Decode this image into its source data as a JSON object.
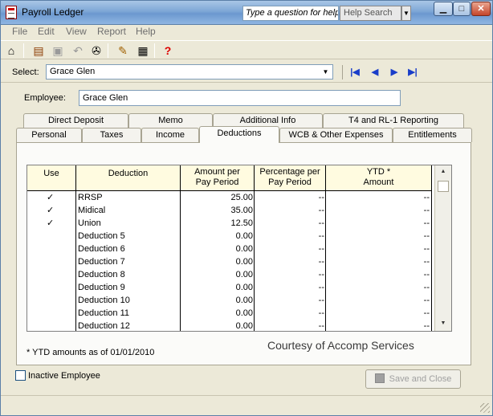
{
  "window": {
    "title": "Payroll Ledger"
  },
  "help": {
    "question_placeholder": "Type a question for help",
    "search_label": "Help Search"
  },
  "menu": [
    "File",
    "Edit",
    "View",
    "Report",
    "Help"
  ],
  "select": {
    "label": "Select:",
    "value": "Grace Glen"
  },
  "employee": {
    "label": "Employee:",
    "value": "Grace Glen"
  },
  "tabs_back": [
    "Direct Deposit",
    "Memo",
    "Additional Info",
    "T4 and RL-1 Reporting"
  ],
  "tabs_front": [
    "Personal",
    "Taxes",
    "Income",
    "Deductions",
    "WCB & Other Expenses",
    "Entitlements"
  ],
  "active_tab": "Deductions",
  "table": {
    "headers": [
      "Use",
      "Deduction",
      "Amount per Pay Period",
      "Percentage per Pay Period",
      "YTD * Amount"
    ],
    "rows": [
      {
        "use": "✓",
        "deduction": "RRSP",
        "amount": "25.00",
        "percentage": "--",
        "ytd": "--"
      },
      {
        "use": "✓",
        "deduction": "Midical",
        "amount": "35.00",
        "percentage": "--",
        "ytd": "--"
      },
      {
        "use": "✓",
        "deduction": "Union",
        "amount": "12.50",
        "percentage": "--",
        "ytd": "--"
      },
      {
        "use": "",
        "deduction": "Deduction 5",
        "amount": "0.00",
        "percentage": "--",
        "ytd": "--"
      },
      {
        "use": "",
        "deduction": "Deduction 6",
        "amount": "0.00",
        "percentage": "--",
        "ytd": "--"
      },
      {
        "use": "",
        "deduction": "Deduction 7",
        "amount": "0.00",
        "percentage": "--",
        "ytd": "--"
      },
      {
        "use": "",
        "deduction": "Deduction 8",
        "amount": "0.00",
        "percentage": "--",
        "ytd": "--"
      },
      {
        "use": "",
        "deduction": "Deduction 9",
        "amount": "0.00",
        "percentage": "--",
        "ytd": "--"
      },
      {
        "use": "",
        "deduction": "Deduction 10",
        "amount": "0.00",
        "percentage": "--",
        "ytd": "--"
      },
      {
        "use": "",
        "deduction": "Deduction 11",
        "amount": "0.00",
        "percentage": "--",
        "ytd": "--"
      },
      {
        "use": "",
        "deduction": "Deduction 12",
        "amount": "0.00",
        "percentage": "--",
        "ytd": "--"
      }
    ]
  },
  "footnote": "* YTD amounts as of 01/01/2010",
  "courtesy": "Courtesy of Accomp Services",
  "inactive_label": "Inactive Employee",
  "save_close_label": "Save and Close"
}
